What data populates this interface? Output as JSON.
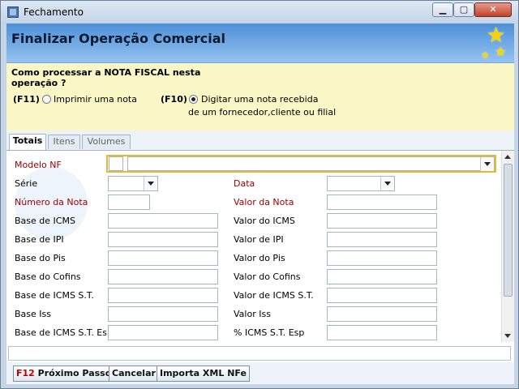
{
  "window": {
    "title": "Fechamento",
    "icons": {
      "minimize": "minimize-icon",
      "maximize": "maximize-icon",
      "close": "close-icon"
    }
  },
  "banner": {
    "title": "Finalizar Operação Comercial",
    "decoration": "stars-icon"
  },
  "question": {
    "prompt": "Como processar a NOTA FISCAL nesta operação ?",
    "option_f11": {
      "key": "(F11)",
      "label": "Imprimir uma nota",
      "selected": false
    },
    "option_f10": {
      "key": "(F10)",
      "label_line1": "Digitar uma nota recebida",
      "label_line2": "de um fornecedor,cliente ou filial",
      "selected": true
    }
  },
  "tabs": [
    {
      "label": "Totais",
      "active": true
    },
    {
      "label": "Itens",
      "active": false
    },
    {
      "label": "Volumes",
      "active": false
    }
  ],
  "form": {
    "modelo_nf": {
      "label": "Modelo NF",
      "code": "",
      "value": ""
    },
    "serie": {
      "label": "Série",
      "value": ""
    },
    "data": {
      "label": "Data",
      "value": ""
    },
    "numero_nota": {
      "label": "Número da Nota",
      "value": ""
    },
    "valor_nota": {
      "label": "Valor da Nota",
      "value": ""
    },
    "base_icms": {
      "label": "Base de ICMS",
      "value": ""
    },
    "valor_icms": {
      "label": "Valor do ICMS",
      "value": ""
    },
    "base_ipi": {
      "label": "Base de IPI",
      "value": ""
    },
    "valor_ipi": {
      "label": "Valor de IPI",
      "value": ""
    },
    "base_pis": {
      "label": "Base do Pis",
      "value": ""
    },
    "valor_pis": {
      "label": "Valor do Pis",
      "value": ""
    },
    "base_cofins": {
      "label": "Base do Cofins",
      "value": ""
    },
    "valor_cofins": {
      "label": "Valor do Cofins",
      "value": ""
    },
    "base_icms_st": {
      "label": "Base de ICMS S.T.",
      "value": ""
    },
    "valor_icms_st": {
      "label": "Valor de ICMS S.T.",
      "value": ""
    },
    "base_iss": {
      "label": "Base Iss",
      "value": ""
    },
    "valor_iss": {
      "label": "Valor Iss",
      "value": ""
    },
    "base_icms_st_esp": {
      "label": "Base de ICMS S.T. Esp",
      "value": ""
    },
    "pct_icms_st_esp": {
      "label": "% ICMS S.T. Esp",
      "value": ""
    }
  },
  "buttons": {
    "next": {
      "key": "F12",
      "label": "Próximo Passo"
    },
    "cancel": {
      "label": "Cancelar"
    },
    "import": {
      "label": "Importa XML NFe"
    }
  },
  "colors": {
    "banner": "#4e8fd8",
    "question_bg": "#fbf6c6",
    "required_label": "#a00000",
    "focus_border": "#e8b830",
    "key_red": "#c00000"
  }
}
